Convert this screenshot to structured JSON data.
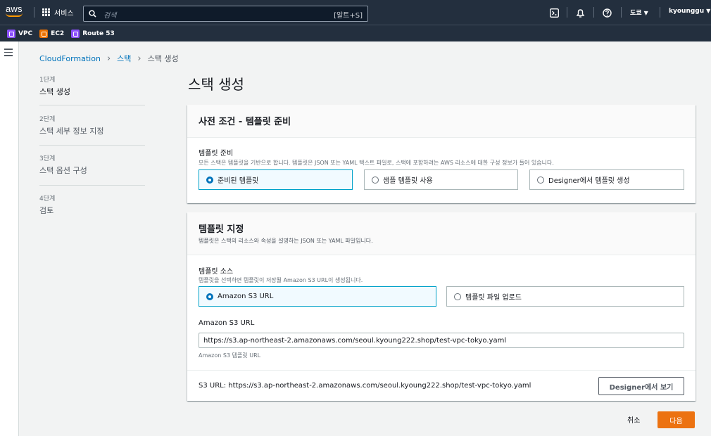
{
  "topnav": {
    "logo": "aws",
    "services_label": "서비스",
    "search_placeholder": "검색",
    "search_shortcut": "[알트+S]",
    "region": "도쿄",
    "user": "kyounggu"
  },
  "favorites": [
    {
      "label": "VPC",
      "icon": "vpc-icon"
    },
    {
      "label": "EC2",
      "icon": "ec2-icon"
    },
    {
      "label": "Route 53",
      "icon": "route53-icon"
    }
  ],
  "breadcrumb": {
    "root": "CloudFormation",
    "parent": "스택",
    "current": "스택 생성"
  },
  "steps": [
    {
      "num": "1단계",
      "name": "스택 생성"
    },
    {
      "num": "2단계",
      "name": "스택 세부 정보 지정"
    },
    {
      "num": "3단계",
      "name": "스택 옵션 구성"
    },
    {
      "num": "4단계",
      "name": "검토"
    }
  ],
  "page_title": "스택 생성",
  "prereq": {
    "title": "사전 조건 - 템플릿 준비",
    "field_label": "템플릿 준비",
    "field_desc": "모든 스택은 템플릿을 기반으로 합니다. 템플릿은 JSON 또는 YAML 텍스트 파일로, 스택에 포함하려는 AWS 리소스에 대한 구성 정보가 들어 있습니다.",
    "options": [
      "준비된 템플릿",
      "샘플 템플릿 사용",
      "Designer에서 템플릿 생성"
    ],
    "selected": "준비된 템플릿"
  },
  "spec": {
    "title": "템플릿 지정",
    "desc": "템플릿은 스택의 리소스와 속성을 설명하는 JSON 또는 YAML 파일입니다.",
    "source_label": "템플릿 소스",
    "source_desc": "템플릿을 선택하면 템플릿이 저장될 Amazon S3 URL이 생성됩니다.",
    "source_options": [
      "Amazon S3 URL",
      "템플릿 파일 업로드"
    ],
    "selected": "Amazon S3 URL",
    "url_label": "Amazon S3 URL",
    "url_value": "https://s3.ap-northeast-2.amazonaws.com/seoul.kyoung222.shop/test-vpc-tokyo.yaml",
    "url_hint": "Amazon S3 템플릿 URL",
    "footer_url": "S3 URL:  https://s3.ap-northeast-2.amazonaws.com/seoul.kyoung222.shop/test-vpc-tokyo.yaml",
    "designer_button": "Designer에서 보기"
  },
  "actions": {
    "cancel": "취소",
    "next": "다음"
  },
  "colors": {
    "nav_bg": "#232f3e",
    "accent_orange": "#ec7211",
    "link_blue": "#0073bb",
    "selected_border": "#00a1c9"
  }
}
